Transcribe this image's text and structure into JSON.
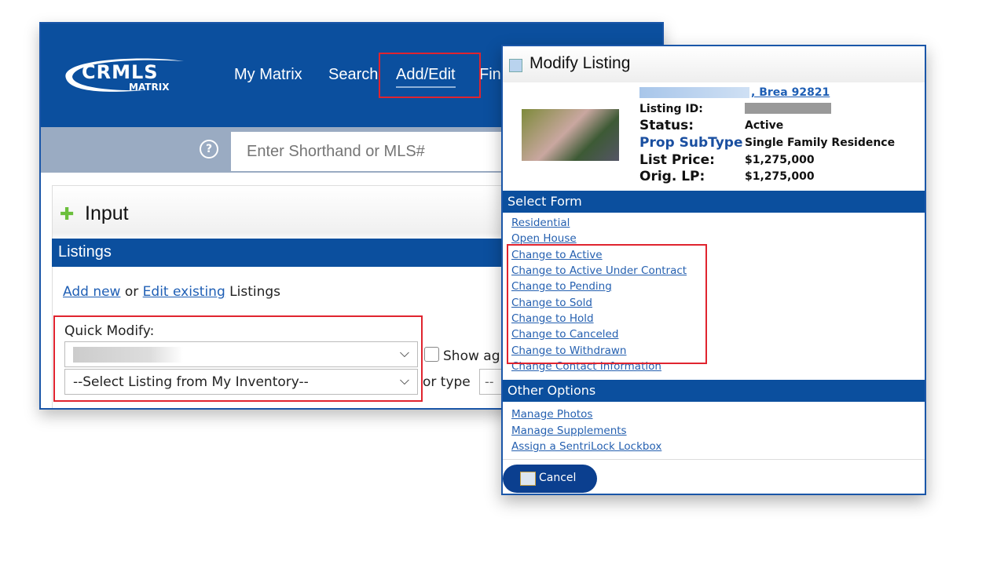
{
  "main": {
    "logo": {
      "line1": "CRMLS",
      "line2": "MATRIX"
    },
    "nav": [
      "My Matrix",
      "Search",
      "Add/Edit",
      "Fin"
    ],
    "search_placeholder": "Enter Shorthand or MLS#",
    "help_icon": "?",
    "panel_title": "Input",
    "section": "Listings",
    "add_new": "Add new",
    "or": "or",
    "edit_existing": "Edit existing",
    "listings_word": "Listings",
    "quick_modify_label": "Quick Modify:",
    "select_inventory": "--Select Listing from My Inventory--",
    "show_label": "Show ag",
    "or_type": "or type",
    "type_value": "-- ",
    "accent": "#0b4f9e",
    "highlight": "#e0242f"
  },
  "modal": {
    "title": "Modify Listing",
    "address": ", Brea 92821",
    "fields": [
      {
        "label": "Listing ID:",
        "value": ""
      },
      {
        "label": "Status:",
        "value": "Active"
      },
      {
        "label": "Prop SubType",
        "value": "Single Family Residence"
      },
      {
        "label": "List Price:",
        "value": "$1,275,000"
      },
      {
        "label": "Orig. LP:",
        "value": "$1,275,000"
      }
    ],
    "select_form": "Select Form",
    "form_links": [
      "Residential",
      "Open House",
      "Change to Active",
      "Change to Active Under Contract",
      "Change to Pending",
      "Change to Sold",
      "Change to Hold",
      "Change to Canceled",
      "Change to Withdrawn",
      "Change Contact Information"
    ],
    "other_options": "Other Options",
    "other_links": [
      "Manage Photos",
      "Manage Supplements",
      "Assign a SentriLock Lockbox"
    ],
    "cancel": "Cancel"
  }
}
